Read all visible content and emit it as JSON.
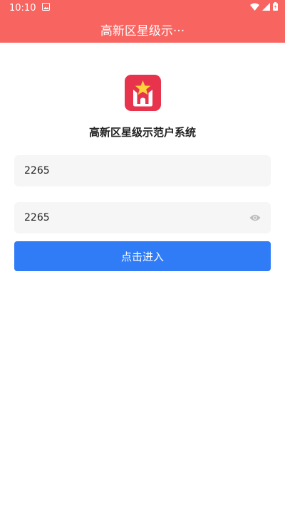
{
  "status_bar": {
    "time": "10:10",
    "icons": [
      "image-icon",
      "wifi-icon",
      "signal-icon",
      "battery-icon"
    ]
  },
  "app_bar": {
    "title": "高新区星级示···",
    "color": "#f86460"
  },
  "main": {
    "logo_icon": "star-house-logo-icon",
    "app_name": "高新区星级示范户系统",
    "username_value": "2265",
    "password_value": "2265",
    "login_label": "点击进入",
    "accent_color": "#2f7cf6"
  }
}
